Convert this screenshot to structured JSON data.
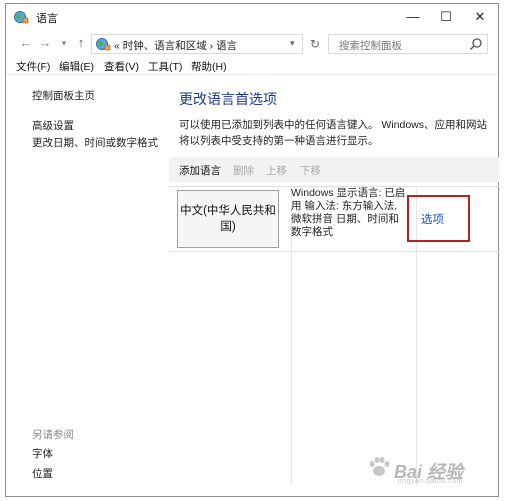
{
  "window": {
    "title": "语言",
    "controls": {
      "minimize": "—",
      "maximize": "☐",
      "close": "✕"
    }
  },
  "address_bar": {
    "back": "←",
    "forward": "→",
    "history_dropdown": "▾",
    "up": "↑",
    "path": "« 时钟、语言和区域 › 语言",
    "path_dropdown": "▾",
    "refresh": "↻",
    "search_placeholder": "搜索控制面板"
  },
  "menu": {
    "items": [
      "文件(F)",
      "编辑(E)",
      "查看(V)",
      "工具(T)",
      "帮助(H)"
    ]
  },
  "sidebar": {
    "home": "控制面板主页",
    "advanced": "高级设置",
    "datetime": "更改日期、时间或数字格式",
    "see_also": "另请参阅",
    "fonts": "字体",
    "location": "位置"
  },
  "main": {
    "heading": "更改语言首选项",
    "description": "可以使用已添加到列表中的任何语言键入。 Windows、应用和网站将以列表中受支持的第一种语言进行显示。",
    "toolbar": {
      "add": "添加语言",
      "remove": "删除",
      "move_up": "上移",
      "move_down": "下移"
    },
    "language": {
      "name": "中文(中华人民共和国)",
      "details": "Windows 显示语言: 已启用 输入法: 东方输入法, 微软拼音 日期、时间和数字格式",
      "options": "选项"
    }
  },
  "colors": {
    "heading": "#1e3a8a",
    "link": "#1a56c4",
    "highlight": "#b22222",
    "disabled": "#a8a8a8"
  },
  "watermark": {
    "text": "Bai 经验",
    "sub": "jingyan.baidu.com"
  }
}
